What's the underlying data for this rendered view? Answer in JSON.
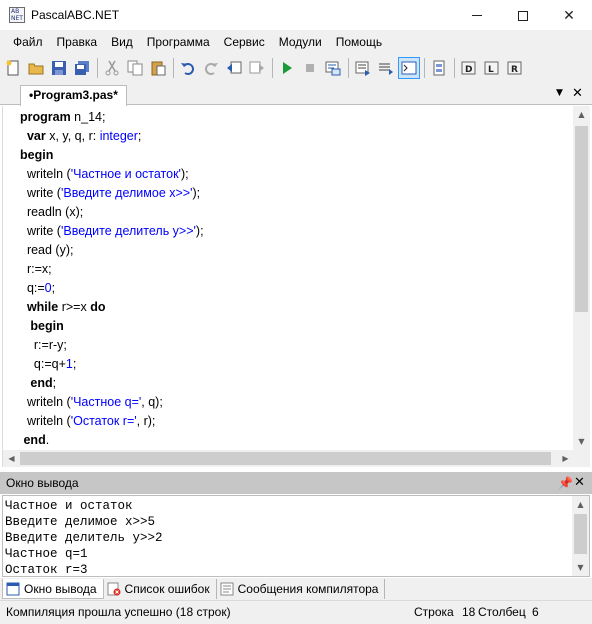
{
  "window": {
    "title": "PascalABC.NET",
    "icon_label": "AB\nNET"
  },
  "menu": [
    "Файл",
    "Правка",
    "Вид",
    "Программа",
    "Сервис",
    "Модули",
    "Помощь"
  ],
  "toolbar": {
    "icons": [
      "new-file-icon",
      "open-folder-icon",
      "save-icon",
      "save-all-icon",
      "cut-icon",
      "copy-icon",
      "paste-icon",
      "undo-icon",
      "redo-icon",
      "back-icon",
      "forward-icon",
      "run-icon",
      "stop-icon",
      "compile-icon",
      "step-icon",
      "console-icon",
      "debug-icon",
      "watch-icon",
      "locals-icon",
      "registers-icon"
    ]
  },
  "editor": {
    "tab_label": "•Program3.pas*",
    "lines": [
      [
        {
          "t": "program",
          "c": "kw"
        },
        {
          "t": " n_14;",
          "c": ""
        }
      ],
      [
        {
          "t": "  ",
          "c": ""
        },
        {
          "t": "var",
          "c": "kw"
        },
        {
          "t": " x, y, q, r: ",
          "c": ""
        },
        {
          "t": "integer",
          "c": "typ"
        },
        {
          "t": ";",
          "c": ""
        }
      ],
      [
        {
          "t": "begin",
          "c": "kw"
        }
      ],
      [
        {
          "t": "  writeln (",
          "c": ""
        },
        {
          "t": "'Частное и остаток'",
          "c": "str"
        },
        {
          "t": ");",
          "c": ""
        }
      ],
      [
        {
          "t": "  write (",
          "c": ""
        },
        {
          "t": "'Введите делимое x>>'",
          "c": "str"
        },
        {
          "t": ");",
          "c": ""
        }
      ],
      [
        {
          "t": "  readln (x);",
          "c": ""
        }
      ],
      [
        {
          "t": "  write (",
          "c": ""
        },
        {
          "t": "'Введите делитель y>>'",
          "c": "str"
        },
        {
          "t": ");",
          "c": ""
        }
      ],
      [
        {
          "t": "  read (y);",
          "c": ""
        }
      ],
      [
        {
          "t": "  r:=x;",
          "c": ""
        }
      ],
      [
        {
          "t": "  q:=",
          "c": ""
        },
        {
          "t": "0",
          "c": "num"
        },
        {
          "t": ";",
          "c": ""
        }
      ],
      [
        {
          "t": "  ",
          "c": ""
        },
        {
          "t": "while",
          "c": "kw"
        },
        {
          "t": " r>=x ",
          "c": ""
        },
        {
          "t": "do",
          "c": "kw"
        }
      ],
      [
        {
          "t": "   ",
          "c": ""
        },
        {
          "t": "begin",
          "c": "kw"
        }
      ],
      [
        {
          "t": "    r:=r-y;",
          "c": ""
        }
      ],
      [
        {
          "t": "    q:=q+",
          "c": ""
        },
        {
          "t": "1",
          "c": "num"
        },
        {
          "t": ";",
          "c": ""
        }
      ],
      [
        {
          "t": "   ",
          "c": ""
        },
        {
          "t": "end",
          "c": "kw"
        },
        {
          "t": ";",
          "c": ""
        }
      ],
      [
        {
          "t": "  writeln (",
          "c": ""
        },
        {
          "t": "'Частное q='",
          "c": "str"
        },
        {
          "t": ", q);",
          "c": ""
        }
      ],
      [
        {
          "t": "  writeln (",
          "c": ""
        },
        {
          "t": "'Остаток r='",
          "c": "str"
        },
        {
          "t": ", r);",
          "c": ""
        }
      ],
      [
        {
          "t": " ",
          "c": ""
        },
        {
          "t": "end",
          "c": "kw"
        },
        {
          "t": ".",
          "c": ""
        }
      ]
    ]
  },
  "output_panel": {
    "title": "Окно вывода",
    "lines": [
      "Частное и остаток",
      "Введите делимое x>>5",
      "Введите делитель y>>2",
      "Частное q=1",
      "Остаток r=3"
    ]
  },
  "bottom_tabs": [
    {
      "label": "Окно вывода",
      "icon": "output-window-icon",
      "active": true
    },
    {
      "label": "Список ошибок",
      "icon": "error-list-icon",
      "active": false
    },
    {
      "label": "Сообщения компилятора",
      "icon": "compiler-messages-icon",
      "active": false
    }
  ],
  "status": {
    "message": "Компиляция прошла успешно (18 строк)",
    "line_label": "Строка",
    "line_value": "18",
    "col_label": "Столбец",
    "col_value": "6"
  },
  "colors": {
    "keyword": "#000000",
    "string": "#0000ff",
    "number": "#0000ff",
    "type": "#0000ff",
    "panel_header": "#c6c6c6"
  }
}
